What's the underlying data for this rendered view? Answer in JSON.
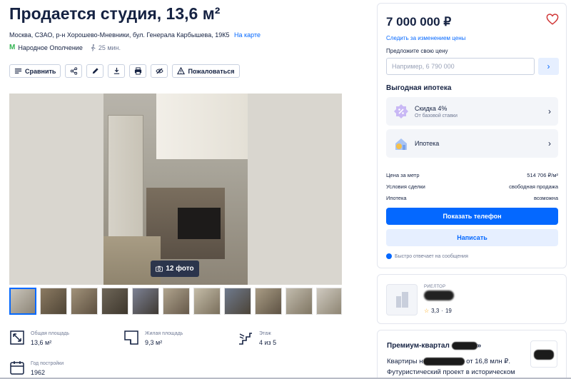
{
  "listing": {
    "title": "Продается студия, 13,6 м²",
    "address": "Москва, СЗАО, р-н Хорошево-Мневники, бул. Генерала Карбышева, 19К5",
    "on_map": "На карте",
    "metro": "Народное Ополчение",
    "walk_time": "25 мин."
  },
  "toolbar": {
    "compare": "Сравнить",
    "report": "Пожаловаться"
  },
  "gallery": {
    "photo_count": "12 фото",
    "thumb_count": 11
  },
  "facts": [
    {
      "label": "Общая площадь",
      "value": "13,6 м²"
    },
    {
      "label": "Жилая площадь",
      "value": "9,3 м²"
    },
    {
      "label": "Этаж",
      "value": "4 из 5"
    },
    {
      "label": "Год постройки",
      "value": "1962"
    }
  ],
  "sidebar": {
    "price": "7 000 000 ₽",
    "follow_price": "Следить за изменением цены",
    "offer_label": "Предложите свою цену",
    "offer_placeholder": "Например, 6 790 000",
    "mortgage_title": "Выгодная ипотека",
    "discount_title": "Скидка 4%",
    "discount_sub": "От базовой ставки",
    "mortgage_item": "Ипотека",
    "rows": [
      {
        "label": "Цена за метр",
        "value": "514 706 ₽/м²"
      },
      {
        "label": "Условия сделки",
        "value": "свободная продажа"
      },
      {
        "label": "Ипотека",
        "value": "возможна"
      }
    ],
    "phone_button": "Показать телефон",
    "write_button": "Написать",
    "fast_reply": "Быстро отвечает на сообщения"
  },
  "agent": {
    "role": "РИЕЛТОР",
    "rating": "3,3",
    "reviews": "19"
  },
  "promo": {
    "title": "Премиум-квартал",
    "line1_a": "Квартиры н",
    "line1_b": "от 16,8 млн ₽.",
    "line2": "Футуристический проект в историческом"
  },
  "colors": {
    "accent": "#0468ff",
    "text": "#152242",
    "muted": "#707a95",
    "heart": "#d03535",
    "metro": "#36b555",
    "star": "#ffa300"
  }
}
